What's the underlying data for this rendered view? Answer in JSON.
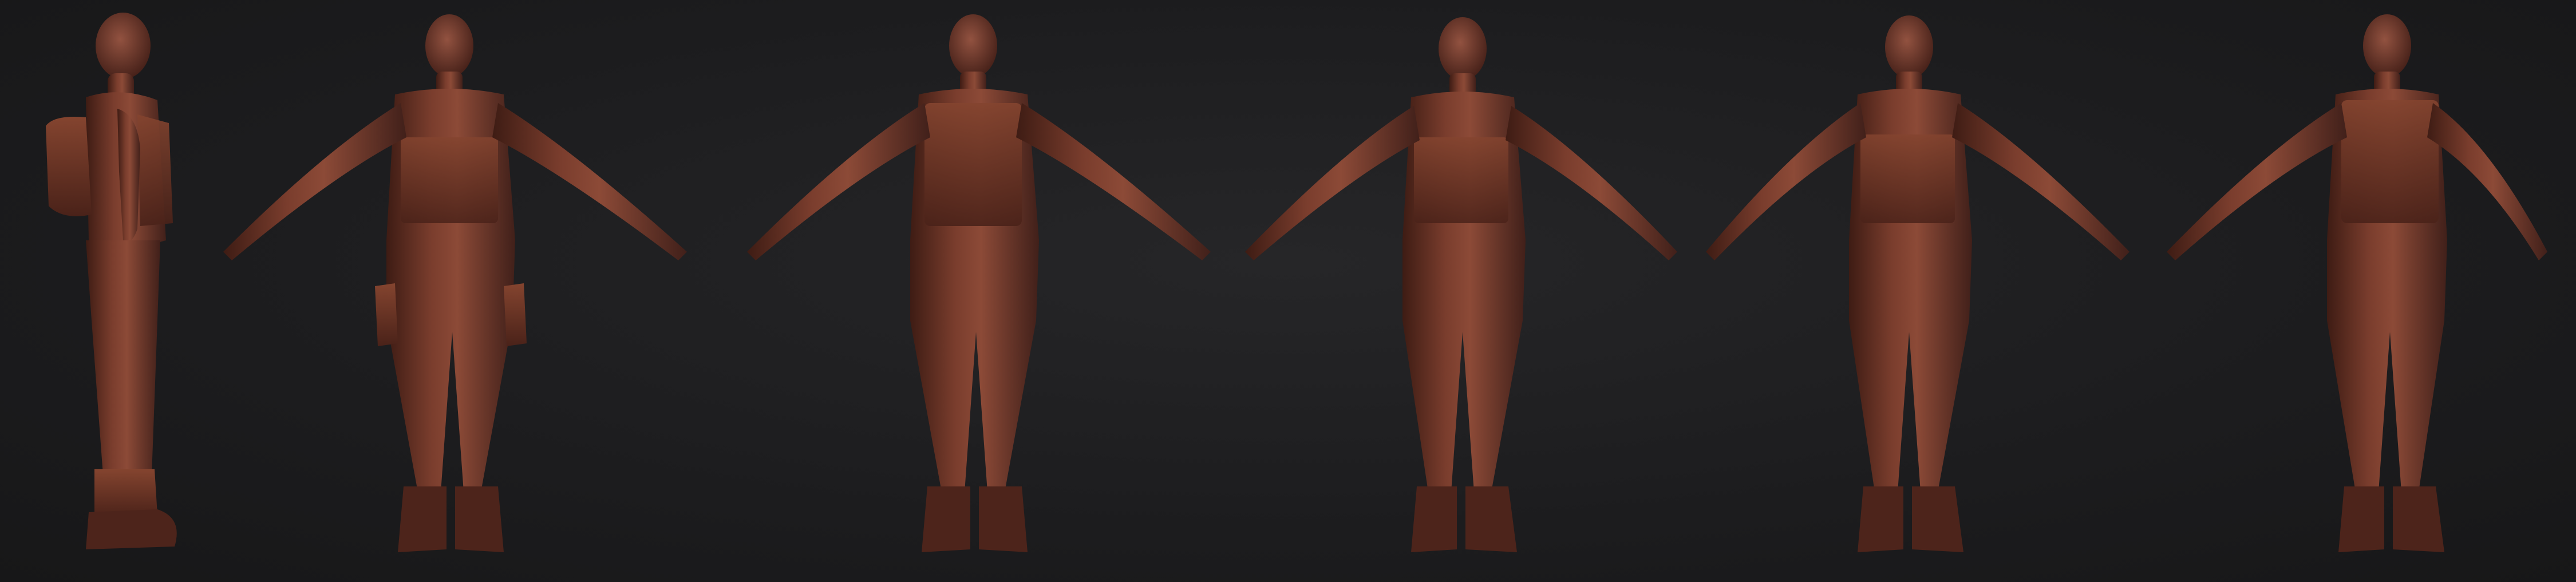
{
  "scene": {
    "subject": "sculpted-soldier-turnaround",
    "background_color": "#1d1d1f",
    "clay_color": "#6b3326",
    "clay_highlight": "#8a4a39",
    "clay_shadow": "#3a1a13",
    "views": [
      {
        "id": "side-left",
        "label": ""
      },
      {
        "id": "front",
        "label": ""
      },
      {
        "id": "back",
        "label": ""
      },
      {
        "id": "front-three-quarter",
        "label": ""
      },
      {
        "id": "front-three-quarter-right",
        "label": ""
      },
      {
        "id": "back-three-quarter",
        "label": ""
      }
    ]
  }
}
